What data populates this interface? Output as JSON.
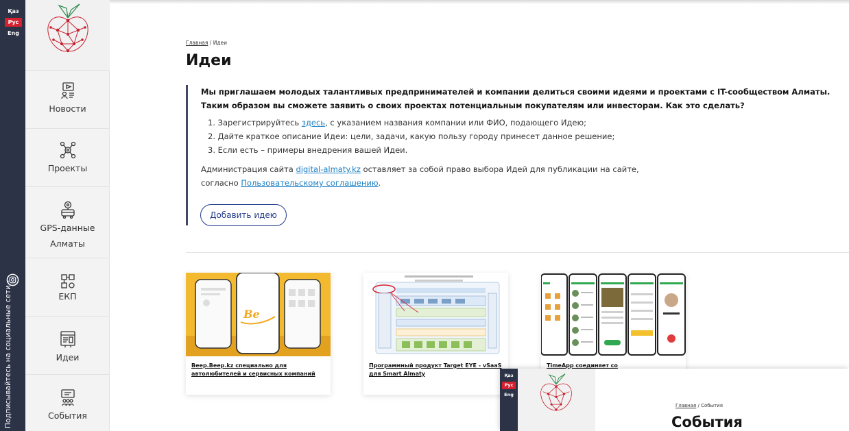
{
  "languages": [
    "Қаз",
    "Рус",
    "Eng"
  ],
  "active_language": "Рус",
  "social": {
    "label": "Подписывайтесь на социальные сети -"
  },
  "nav": [
    {
      "id": "news",
      "label": "Новости",
      "icon": "news-icon"
    },
    {
      "id": "projects",
      "label": "Проекты",
      "icon": "projects-icon"
    },
    {
      "id": "gps",
      "label": "GPS-данные Алматы",
      "icon": "bus-icon"
    },
    {
      "id": "ekp",
      "label": "ЕКП",
      "icon": "ekp-icon"
    },
    {
      "id": "ideas",
      "label": "Идеи",
      "icon": "ideas-icon"
    },
    {
      "id": "events",
      "label": "События",
      "icon": "events-icon"
    }
  ],
  "breadcrumb": {
    "home": "Главная",
    "sep": " / ",
    "current": "Идеи"
  },
  "page_title": "Идеи",
  "intro": {
    "lead_1": "Мы приглашаем молодых талантливых предпринимателей и компании делиться своими идеями и проектами с IT-сообществом Алматы.",
    "lead_2": "Таким образом вы сможете заявить о своих проектах потенциальным покупателям или инвесторам. Как это сделать?",
    "step_1_pre": "1. Зарегистрируйтесь ",
    "step_1_link": "здесь",
    "step_1_post": ", с указанием названия компании или ФИО, подающего Идею;",
    "step_2": "2. Дайте краткое описание Идеи: цели, задачи, какую пользу городу принесет данное решение;",
    "step_3": "3. Если есть – примеры внедрения вашей Идеи.",
    "notice_pre": "Администрация сайта ",
    "notice_link": "digital-almaty.kz",
    "notice_mid": " оставляет за собой право выбора Идей для публикации на сайте,",
    "notice_line2_pre": "согласно ",
    "notice_line2_link": "Пользовательскому соглашению",
    "notice_line2_post": "."
  },
  "add_button": "Добавить идею",
  "cards": [
    {
      "title": "Beep.Beep.kz специально для автолюбителей и сервисных компаний"
    },
    {
      "title": "Программный продукт Target EYE - vSaaS для Smart Almaty"
    },
    {
      "title": "TimeApp соединяет со"
    }
  ],
  "overlay": {
    "languages": [
      "Қаз",
      "Рус",
      "Eng"
    ],
    "breadcrumb": {
      "home": "Главная",
      "sep": " / ",
      "current": "События"
    },
    "page_title": "События"
  },
  "colors": {
    "rail": "#2c3347",
    "accent_red": "#d5202f",
    "link": "#1a7fc4",
    "button_border": "#243b8a"
  }
}
